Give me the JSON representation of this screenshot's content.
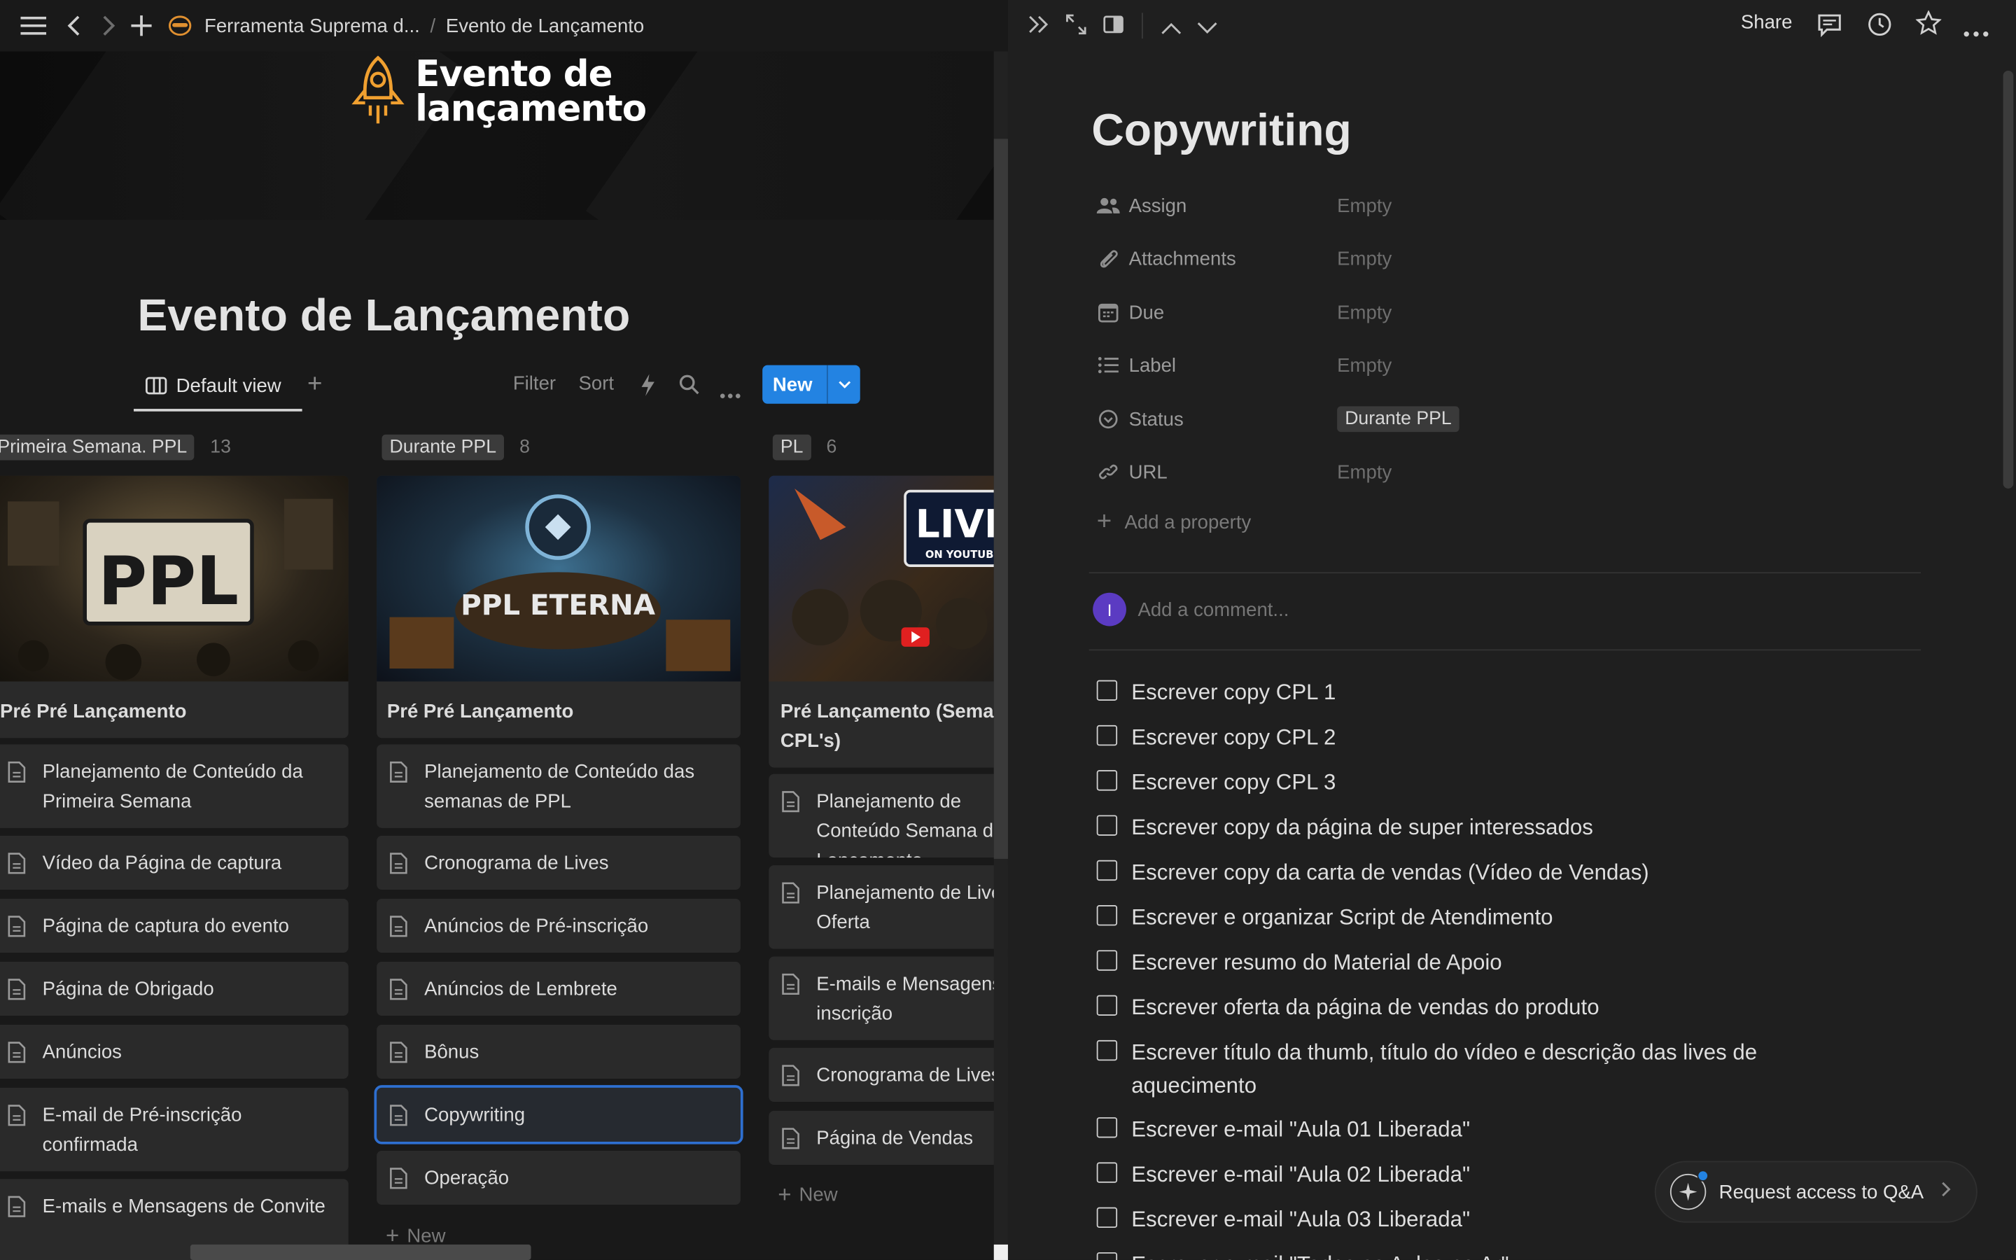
{
  "topbar": {
    "breadcrumb_root": "Ferramenta Suprema d...",
    "breadcrumb_sep": "/",
    "breadcrumb_current": "Evento de Lançamento"
  },
  "cover": {
    "line1": "Evento de",
    "line2": "lançamento"
  },
  "page": {
    "title": "Evento de Lançamento"
  },
  "viewbar": {
    "tab_label": "Default view",
    "filter": "Filter",
    "sort": "Sort",
    "new_label": "New"
  },
  "board": {
    "columns": [
      {
        "tag": "Primeira Semana. PPL",
        "count": "13",
        "card_title": "Pré Pré Lançamento",
        "image_text": "PPL",
        "items": [
          "Planejamento de Conteúdo da Primeira Semana",
          "Vídeo da Página de captura",
          "Página de captura do evento",
          "Página de Obrigado",
          "Anúncios",
          "E-mail de Pré-inscrição confirmada",
          "E-mails e Mensagens de Convite"
        ]
      },
      {
        "tag": "Durante PPL",
        "count": "8",
        "card_title": "Pré Pré Lançamento",
        "image_text": "PPL ETERNA",
        "items": [
          "Planejamento de Conteúdo das semanas de PPL",
          "Cronograma de Lives",
          "Anúncios de Pré-inscrição",
          "Anúncios de Lembrete",
          "Bônus",
          "Copywriting",
          "Operação"
        ],
        "new_label": "New"
      },
      {
        "tag": "PL",
        "count": "6",
        "card_title": "Pré Lançamento (Semana CPL's)",
        "image_text": "LIVE",
        "image_subtext": "ON YOUTUBE",
        "items": [
          "Planejamento de Conteúdo Semana de Lançamento",
          "Planejamento de Live Oferta",
          "E-mails e Mensagens inscrição",
          "Cronograma de Lives",
          "Página de Vendas"
        ],
        "new_label": "New"
      }
    ]
  },
  "detail": {
    "share": "Share",
    "title": "Copywriting",
    "properties": [
      {
        "name": "Assign",
        "value": "Empty",
        "icon": "people-icon"
      },
      {
        "name": "Attachments",
        "value": "Empty",
        "icon": "paperclip-icon"
      },
      {
        "name": "Due",
        "value": "Empty",
        "icon": "calendar-icon"
      },
      {
        "name": "Label",
        "value": "Empty",
        "icon": "list-icon"
      },
      {
        "name": "Status",
        "value": "Durante PPL",
        "icon": "status-icon"
      },
      {
        "name": "URL",
        "value": "Empty",
        "icon": "link-icon"
      }
    ],
    "add_property": "Add a property",
    "avatar_initial": "I",
    "comment_placeholder": "Add a comment...",
    "todos": [
      "Escrever copy CPL 1",
      "Escrever copy CPL 2",
      "Escrever copy CPL 3",
      "Escrever copy da página de super interessados",
      "Escrever copy da carta de vendas (Vídeo de Vendas)",
      "Escrever e organizar Script de Atendimento",
      "Escrever resumo do Material de Apoio",
      "Escrever oferta da página de vendas do produto",
      "Escrever título da thumb, título do vídeo e descrição das lives de aquecimento",
      "Escrever e-mail \"Aula 01 Liberada\"",
      "Escrever e-mail \"Aula 02 Liberada\"",
      "Escrever e-mail \"Aula 03 Liberada\"",
      "Escrever e-mail \"Todas as Aulas no Ar\""
    ],
    "qa_label": "Request access to Q&A"
  }
}
